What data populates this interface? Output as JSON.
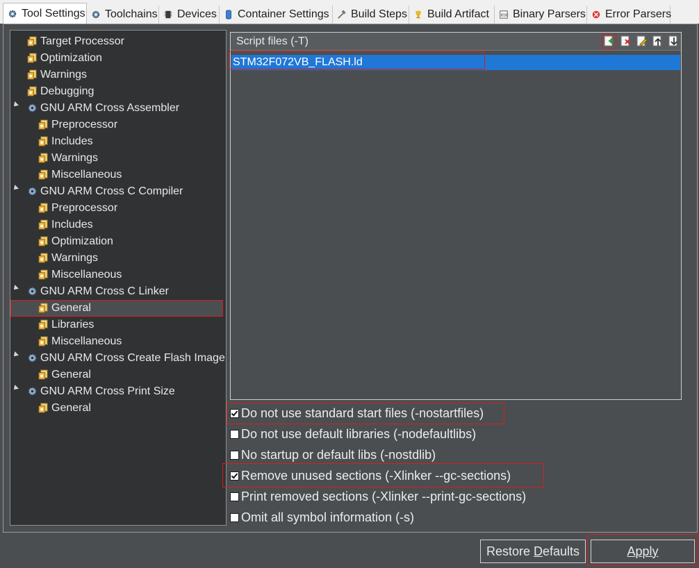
{
  "tabs": [
    {
      "label": "Tool Settings",
      "icon": "gear-icon",
      "active": true
    },
    {
      "label": "Toolchains",
      "icon": "gear-icon"
    },
    {
      "label": "Devices",
      "icon": "chip-icon"
    },
    {
      "label": "Container Settings",
      "icon": "container-icon"
    },
    {
      "label": "Build Steps",
      "icon": "hammer-icon"
    },
    {
      "label": "Build Artifact",
      "icon": "trophy-icon"
    },
    {
      "label": "Binary Parsers",
      "icon": "binary-icon"
    },
    {
      "label": "Error Parsers",
      "icon": "error-icon"
    }
  ],
  "tree": {
    "items": [
      {
        "label": "Target Processor",
        "icon": "settings-page-icon"
      },
      {
        "label": "Optimization",
        "icon": "settings-page-icon"
      },
      {
        "label": "Warnings",
        "icon": "settings-page-icon"
      },
      {
        "label": "Debugging",
        "icon": "settings-page-icon"
      },
      {
        "label": "GNU ARM Cross Assembler",
        "icon": "gear-icon",
        "expanded": true
      },
      {
        "label": "Preprocessor",
        "icon": "settings-page-icon"
      },
      {
        "label": "Includes",
        "icon": "settings-page-icon"
      },
      {
        "label": "Warnings",
        "icon": "settings-page-icon"
      },
      {
        "label": "Miscellaneous",
        "icon": "settings-page-icon"
      },
      {
        "label": "GNU ARM Cross C Compiler",
        "icon": "gear-icon",
        "expanded": true
      },
      {
        "label": "Preprocessor",
        "icon": "settings-page-icon"
      },
      {
        "label": "Includes",
        "icon": "settings-page-icon"
      },
      {
        "label": "Optimization",
        "icon": "settings-page-icon"
      },
      {
        "label": "Warnings",
        "icon": "settings-page-icon"
      },
      {
        "label": "Miscellaneous",
        "icon": "settings-page-icon"
      },
      {
        "label": "GNU ARM Cross C Linker",
        "icon": "gear-icon",
        "expanded": true
      },
      {
        "label": "General",
        "icon": "settings-page-icon",
        "selected": true
      },
      {
        "label": "Libraries",
        "icon": "settings-page-icon"
      },
      {
        "label": "Miscellaneous",
        "icon": "settings-page-icon"
      },
      {
        "label": "GNU ARM Cross Create Flash Image",
        "icon": "gear-icon",
        "expanded": true
      },
      {
        "label": "General",
        "icon": "settings-page-icon"
      },
      {
        "label": "GNU ARM Cross Print Size",
        "icon": "gear-icon",
        "expanded": true
      },
      {
        "label": "General",
        "icon": "settings-page-icon"
      }
    ]
  },
  "script_files": {
    "title": "Script files (-T)",
    "toolbar": [
      "add-icon",
      "delete-icon",
      "edit-icon",
      "move-up-icon",
      "move-down-icon"
    ],
    "files": [
      "STM32F072VB_FLASH.ld"
    ]
  },
  "options": [
    {
      "label": "Do not use standard start files (-nostartfiles)",
      "checked": true
    },
    {
      "label": "Do not use default libraries (-nodefaultlibs)",
      "checked": false
    },
    {
      "label": "No startup or default libs (-nostdlib)",
      "checked": false
    },
    {
      "label": "Remove unused sections (-Xlinker --gc-sections)",
      "checked": true
    },
    {
      "label": "Print removed sections (-Xlinker --print-gc-sections)",
      "checked": false
    },
    {
      "label": "Omit all symbol information (-s)",
      "checked": false
    }
  ],
  "buttons": {
    "restore_prefix": "Restore ",
    "restore_underlined": "D",
    "restore_suffix": "efaults",
    "apply_underlined": "A",
    "apply_suffix": "pply"
  },
  "colors": {
    "selection": "#1f77d6",
    "highlight_box": "#d81e1e",
    "tree_bg": "#303234",
    "panel_bg": "#4a4e51"
  }
}
